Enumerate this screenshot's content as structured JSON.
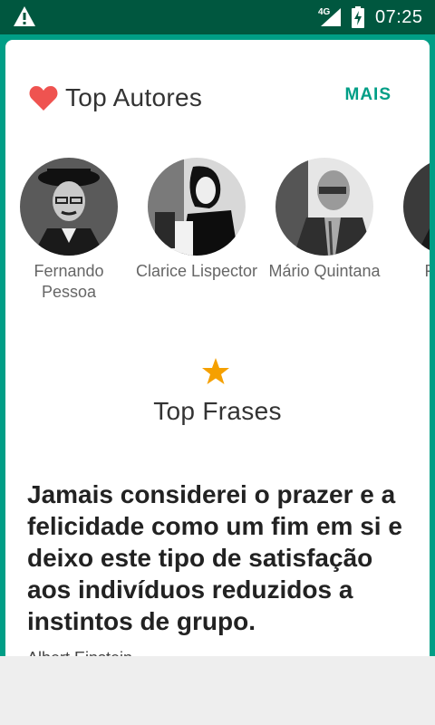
{
  "status_bar": {
    "network": "4G",
    "time": "07:25",
    "color": "#00573f"
  },
  "colors": {
    "accent": "#009e86",
    "heart": "#ef5350",
    "star": "#f5a000"
  },
  "top_autores": {
    "title": "Top Autores",
    "more_label": "MAIS",
    "authors": [
      {
        "name": "Fernando Pessoa"
      },
      {
        "name": "Clarice Lispector"
      },
      {
        "name": "Mário Quintana"
      },
      {
        "name": "F... Ni..."
      }
    ]
  },
  "top_frases": {
    "title": "Top Frases",
    "quote_text": "Jamais considerei o prazer e a felicidade como um fim em si e deixo este tipo de satisfação aos indivíduos reduzidos a instintos de grupo.",
    "quote_author": "Albert Einstein"
  }
}
